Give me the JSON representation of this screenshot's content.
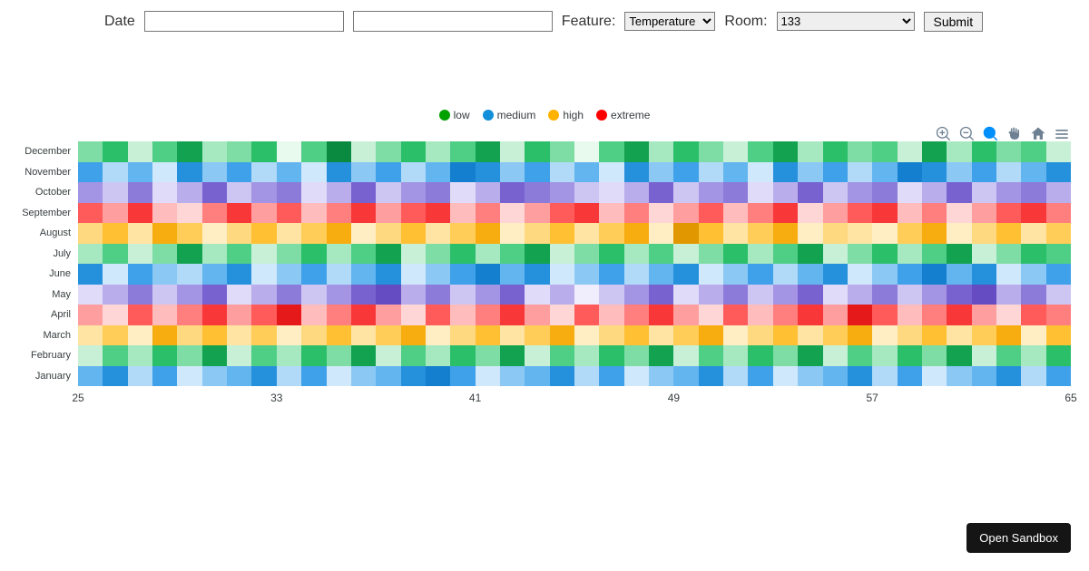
{
  "controls": {
    "date_label": "Date",
    "date_a": "",
    "date_b": "",
    "feature_label": "Feature:",
    "feature_selected": "Temperature",
    "room_label": "Room:",
    "room_selected": "133",
    "submit_label": "Submit"
  },
  "legend": {
    "low": "low",
    "medium": "medium",
    "high": "high",
    "extreme": "extreme"
  },
  "toolbar": {
    "zoom_in": "zoom-in",
    "zoom_out": "zoom-out",
    "zoom": "zoom",
    "pan": "pan",
    "reset": "reset",
    "menu": "menu"
  },
  "sandbox_button": "Open Sandbox",
  "chart_data": {
    "type": "heatmap",
    "title": "",
    "xlabel": "",
    "ylabel": "",
    "x_range": [
      25,
      65
    ],
    "x_ticks": [
      25,
      33,
      41,
      49,
      57,
      65
    ],
    "y_categories": [
      "December",
      "November",
      "October",
      "September",
      "August",
      "July",
      "June",
      "May",
      "April",
      "March",
      "February",
      "January"
    ],
    "legend_levels": [
      {
        "name": "low",
        "color": "#00a100"
      },
      {
        "name": "medium",
        "color": "#128fd9"
      },
      {
        "name": "high",
        "color": "#ffb200"
      },
      {
        "name": "extreme",
        "color": "#ff0000"
      }
    ],
    "palettes": {
      "low": [
        "#e8f9ee",
        "#c8f0d7",
        "#a6e8c0",
        "#7ddda5",
        "#4fce86",
        "#2bbf6a",
        "#13a24f",
        "#0a8a40"
      ],
      "medium": [
        "#e9f4fd",
        "#cfe8fb",
        "#b0daf8",
        "#8cc8f4",
        "#63b5ef",
        "#3ea1e9",
        "#2590dc",
        "#137fce"
      ],
      "high": [
        "#fff6e0",
        "#ffeec4",
        "#ffe4a3",
        "#ffd97f",
        "#ffcd58",
        "#ffc033",
        "#f7ad10",
        "#e09700"
      ],
      "extreme": [
        "#ffecec",
        "#ffd6d6",
        "#ffbcbc",
        "#ff9e9e",
        "#ff7e7e",
        "#ff5b5b",
        "#f83838",
        "#e51919"
      ],
      "purple": [
        "#f0eefc",
        "#e0dbf8",
        "#cec6f2",
        "#b9aeeb",
        "#a395e3",
        "#8d7bda",
        "#7862cf",
        "#654cc2"
      ]
    },
    "series": [
      {
        "name": "December",
        "level": "low",
        "intensity": [
          3,
          5,
          1,
          4,
          6,
          2,
          3,
          5,
          0,
          4,
          7,
          1,
          3,
          5,
          2,
          4,
          6,
          1,
          5,
          3,
          0,
          4,
          6,
          2,
          5,
          3,
          1,
          4,
          6,
          2,
          5,
          3,
          4,
          1,
          6,
          2,
          5,
          3,
          4,
          1
        ]
      },
      {
        "name": "November",
        "level": "medium",
        "intensity": [
          5,
          2,
          4,
          1,
          6,
          3,
          5,
          2,
          4,
          1,
          6,
          3,
          5,
          2,
          4,
          7,
          6,
          3,
          5,
          2,
          4,
          1,
          6,
          3,
          5,
          2,
          4,
          1,
          6,
          3,
          5,
          2,
          4,
          7,
          6,
          3,
          5,
          2,
          4,
          6
        ]
      },
      {
        "name": "October",
        "level": "purple",
        "intensity": [
          4,
          2,
          5,
          1,
          3,
          6,
          2,
          4,
          5,
          1,
          3,
          6,
          2,
          4,
          5,
          1,
          3,
          6,
          5,
          4,
          2,
          1,
          3,
          6,
          2,
          4,
          5,
          1,
          3,
          6,
          2,
          4,
          5,
          1,
          3,
          6,
          2,
          4,
          5,
          3
        ]
      },
      {
        "name": "September",
        "level": "extreme",
        "intensity": [
          5,
          3,
          6,
          2,
          1,
          4,
          6,
          3,
          5,
          2,
          4,
          6,
          3,
          5,
          6,
          2,
          4,
          1,
          3,
          5,
          6,
          2,
          4,
          1,
          3,
          5,
          2,
          4,
          6,
          1,
          3,
          5,
          6,
          2,
          4,
          1,
          3,
          5,
          6,
          4
        ]
      },
      {
        "name": "August",
        "level": "high",
        "intensity": [
          3,
          5,
          2,
          6,
          4,
          1,
          3,
          5,
          2,
          4,
          6,
          1,
          3,
          5,
          2,
          4,
          6,
          1,
          3,
          5,
          2,
          4,
          6,
          1,
          7,
          5,
          2,
          4,
          6,
          1,
          3,
          2,
          1,
          4,
          6,
          1,
          3,
          5,
          2,
          4
        ]
      },
      {
        "name": "July",
        "level": "low",
        "intensity": [
          2,
          4,
          1,
          3,
          6,
          2,
          4,
          1,
          3,
          5,
          2,
          4,
          6,
          1,
          3,
          5,
          2,
          4,
          6,
          1,
          3,
          5,
          2,
          4,
          1,
          3,
          5,
          2,
          4,
          6,
          1,
          3,
          5,
          2,
          4,
          6,
          1,
          3,
          5,
          4
        ]
      },
      {
        "name": "June",
        "level": "medium",
        "intensity": [
          6,
          1,
          5,
          3,
          2,
          4,
          6,
          1,
          3,
          5,
          2,
          4,
          6,
          1,
          3,
          5,
          7,
          4,
          6,
          1,
          3,
          5,
          2,
          4,
          6,
          1,
          3,
          5,
          2,
          4,
          6,
          1,
          3,
          5,
          7,
          4,
          6,
          1,
          3,
          5
        ]
      },
      {
        "name": "May",
        "level": "purple",
        "intensity": [
          1,
          3,
          5,
          2,
          4,
          6,
          1,
          3,
          5,
          2,
          4,
          6,
          7,
          3,
          5,
          2,
          4,
          6,
          1,
          3,
          0,
          2,
          4,
          6,
          1,
          3,
          5,
          2,
          4,
          6,
          1,
          3,
          5,
          2,
          4,
          6,
          7,
          3,
          5,
          2
        ]
      },
      {
        "name": "April",
        "level": "extreme",
        "intensity": [
          3,
          1,
          5,
          2,
          4,
          6,
          3,
          5,
          7,
          2,
          4,
          6,
          3,
          1,
          5,
          2,
          4,
          6,
          3,
          1,
          5,
          2,
          4,
          6,
          3,
          1,
          5,
          2,
          4,
          6,
          3,
          7,
          5,
          2,
          4,
          6,
          3,
          1,
          5,
          4
        ]
      },
      {
        "name": "March",
        "level": "high",
        "intensity": [
          2,
          4,
          1,
          6,
          3,
          5,
          2,
          4,
          1,
          3,
          5,
          2,
          4,
          6,
          1,
          3,
          5,
          2,
          4,
          6,
          1,
          3,
          5,
          2,
          4,
          6,
          1,
          3,
          5,
          2,
          4,
          6,
          1,
          3,
          5,
          2,
          4,
          6,
          1,
          5
        ]
      },
      {
        "name": "February",
        "level": "low",
        "intensity": [
          1,
          4,
          2,
          5,
          3,
          6,
          1,
          4,
          2,
          5,
          3,
          6,
          1,
          4,
          2,
          5,
          3,
          6,
          1,
          4,
          2,
          5,
          3,
          6,
          1,
          4,
          2,
          5,
          3,
          6,
          1,
          4,
          2,
          5,
          3,
          6,
          1,
          4,
          2,
          5
        ]
      },
      {
        "name": "January",
        "level": "medium",
        "intensity": [
          4,
          6,
          2,
          5,
          1,
          3,
          4,
          6,
          2,
          5,
          1,
          3,
          4,
          6,
          7,
          5,
          1,
          3,
          4,
          6,
          2,
          5,
          1,
          3,
          4,
          6,
          2,
          5,
          1,
          3,
          4,
          6,
          2,
          5,
          1,
          3,
          4,
          6,
          2,
          5
        ]
      }
    ]
  }
}
